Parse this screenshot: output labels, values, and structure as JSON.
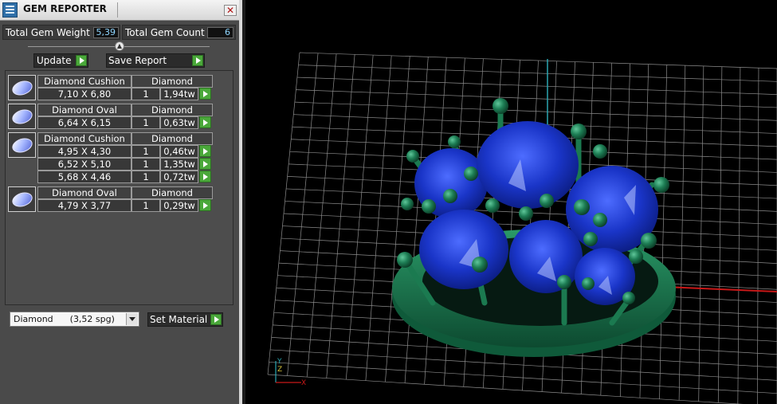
{
  "window": {
    "title": "GEM REPORTER",
    "close": "✕"
  },
  "summary": {
    "weight_label": "Total Gem Weight",
    "weight_value": "5,39",
    "count_label": "Total Gem Count",
    "count_value": "6"
  },
  "buttons": {
    "update": "Update",
    "save_report": "Save Report",
    "set_material": "Set Material"
  },
  "groups": [
    {
      "name": "Diamond Cushion",
      "material": "Diamond",
      "rows": [
        {
          "size": "7,10 X 6,80",
          "qty": "1",
          "weight": "1,94tw"
        }
      ]
    },
    {
      "name": "Diamond Oval",
      "material": "Diamond",
      "rows": [
        {
          "size": "6,64 X 6,15",
          "qty": "1",
          "weight": "0,63tw"
        }
      ]
    },
    {
      "name": "Diamond Cushion",
      "material": "Diamond",
      "rows": [
        {
          "size": "4,95 X 4,30",
          "qty": "1",
          "weight": "0,46tw"
        },
        {
          "size": "6,52 X 5,10",
          "qty": "1",
          "weight": "1,35tw"
        },
        {
          "size": "5,68 X 4,46",
          "qty": "1",
          "weight": "0,72tw"
        }
      ]
    },
    {
      "name": "Diamond Oval",
      "material": "Diamond",
      "rows": [
        {
          "size": "4,79 X 3,77",
          "qty": "1",
          "weight": "0,29tw"
        }
      ]
    }
  ],
  "material_select": {
    "value": "Diamond      (3,52 spg)"
  },
  "viewport": {
    "axis_labels": {
      "x": "X",
      "y": "Y",
      "z": "Z"
    },
    "colors": {
      "grid": "#8c8c8c",
      "metal": "#1c7a52",
      "gem": "#1636c0",
      "x_axis": "#c81818",
      "z_axis": "#2aa6b0"
    }
  },
  "icons": {
    "app": "gem-reporter-icon",
    "close": "close-icon",
    "play": "play-arrow-icon",
    "gem_thumb": "gem-thumbnail-icon",
    "dropdown": "chevron-down-icon"
  }
}
